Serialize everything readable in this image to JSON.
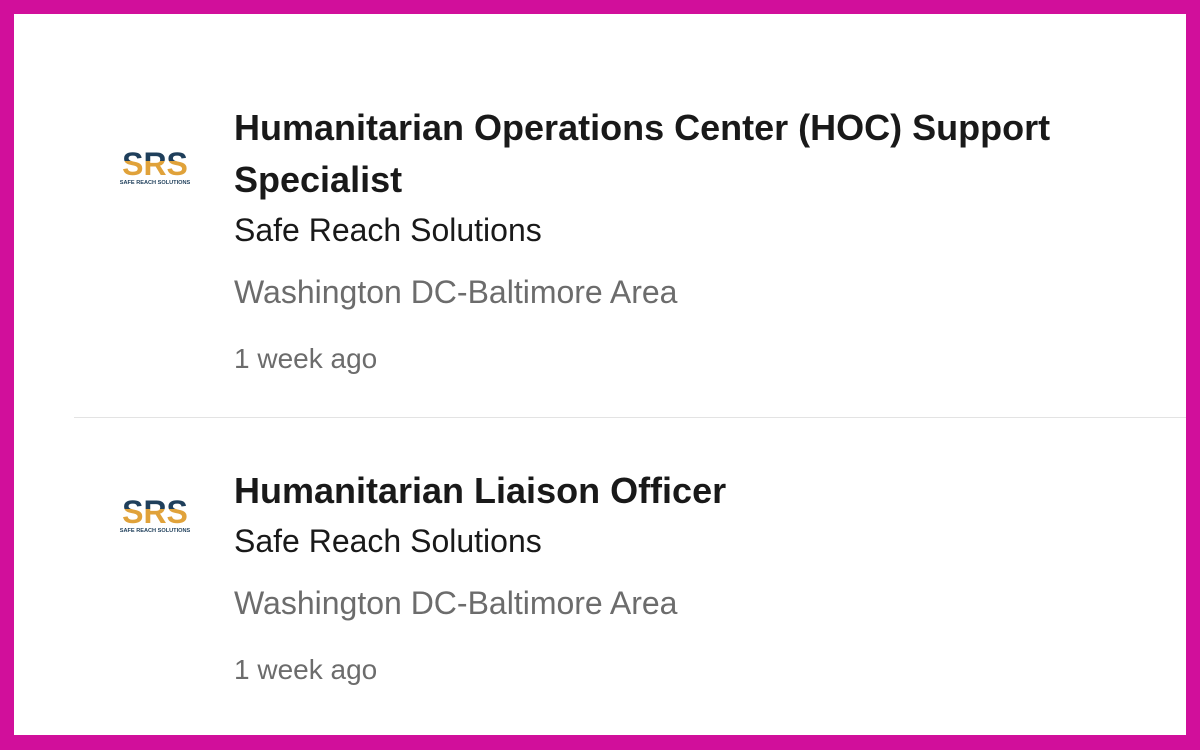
{
  "jobs": [
    {
      "title": "Humanitarian Operations Center (HOC) Support Specialist",
      "company": "Safe Reach Solutions",
      "location": "Washington DC-Baltimore Area",
      "posted": "1 week ago",
      "logo": {
        "letters": "SRS",
        "tagline": "SAFE REACH SOLUTIONS"
      }
    },
    {
      "title": "Humanitarian Liaison Officer",
      "company": "Safe Reach Solutions",
      "location": "Washington DC-Baltimore Area",
      "posted": "1 week ago",
      "logo": {
        "letters": "SRS",
        "tagline": "SAFE REACH SOLUTIONS"
      }
    }
  ],
  "colors": {
    "border": "#d10f9b",
    "logo_navy": "#1f3f5b",
    "logo_gold": "#e0a23a",
    "title": "#191919",
    "secondary": "#6c6c6c",
    "divider": "#e3e3e3"
  }
}
